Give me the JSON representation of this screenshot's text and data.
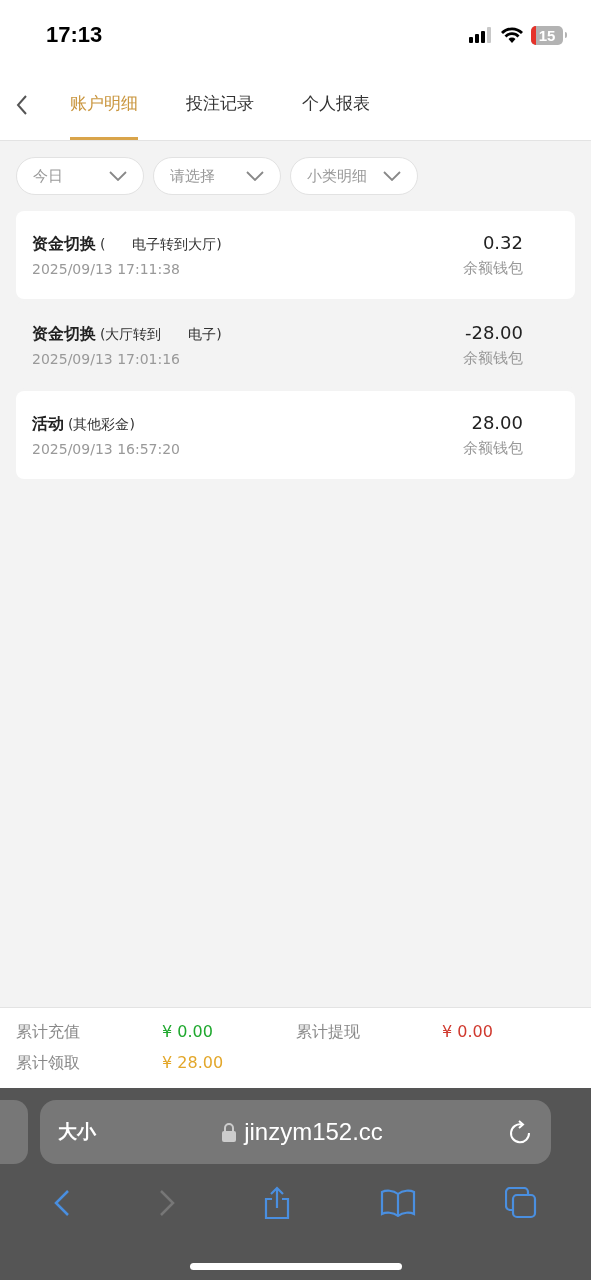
{
  "status_bar": {
    "time": "17:13",
    "battery": "15"
  },
  "tabs": [
    {
      "label": "账户明细",
      "selected": true
    },
    {
      "label": "投注记录",
      "selected": false
    },
    {
      "label": "个人报表",
      "selected": false
    }
  ],
  "filters": [
    {
      "label": "今日"
    },
    {
      "label": "请选择"
    },
    {
      "label": "小类明细"
    }
  ],
  "records": [
    {
      "title": "资金切换",
      "detail": "(      电子转到大厅)",
      "time": "2025/09/13 17:11:38",
      "amount": "0.32",
      "wallet": "余额钱包",
      "highlighted": true
    },
    {
      "title": "资金切换",
      "detail": "(大厅转到      电子)",
      "time": "2025/09/13 17:01:16",
      "amount": "-28.00",
      "wallet": "余额钱包",
      "highlighted": false
    },
    {
      "title": "活动",
      "detail": "(其他彩金)",
      "time": "2025/09/13 16:57:20",
      "amount": "28.00",
      "wallet": "余额钱包",
      "highlighted": true
    }
  ],
  "summary": [
    {
      "label": "累计充值",
      "value": "¥ 0.00",
      "color": "#1fa82e"
    },
    {
      "label": "累计提现",
      "value": "¥ 0.00",
      "color": "#d0392e"
    },
    {
      "label": "累计领取",
      "value": "¥ 28.00",
      "color": "#e3a72a"
    }
  ],
  "browser": {
    "text_size": "大小",
    "url": "jinzym152.cc",
    "back_disabled": false,
    "forward_disabled": true
  }
}
